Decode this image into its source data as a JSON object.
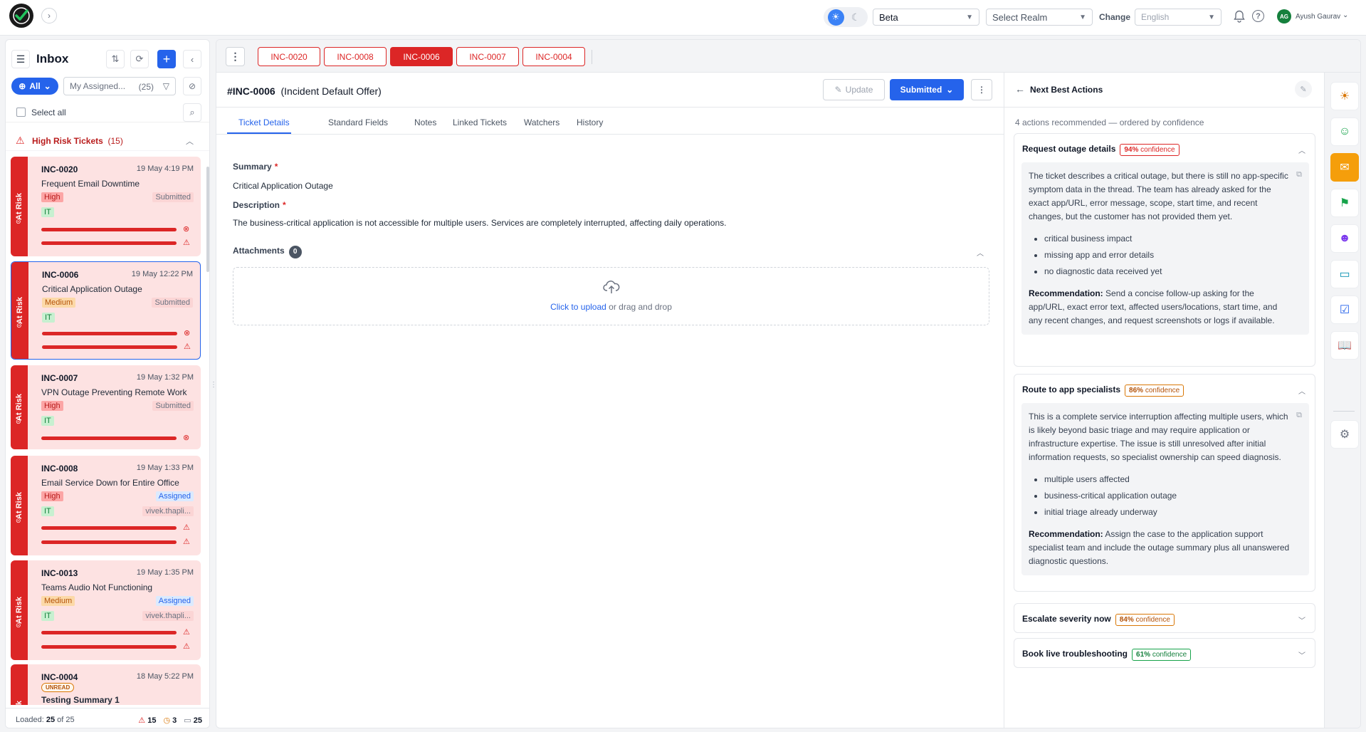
{
  "topbar": {
    "realm_mode_value": "Beta",
    "realm_placeholder": "Select Realm",
    "change_label": "Change",
    "language_value": "English",
    "user_initials": "AG",
    "user_name": "Ayush Gaurav",
    "help_glyph": "?",
    "icons": [
      "app-logo",
      "chevron-right-icon",
      "sun-icon",
      "moon-icon",
      "bell-icon",
      "help-icon",
      "chevron-down-icon"
    ]
  },
  "inbox": {
    "title": "Inbox",
    "filter_all": "All",
    "assigned_label": "My Assigned...",
    "assigned_count": "(25)",
    "select_all": "Select all",
    "group": {
      "title": "High Risk Tickets",
      "count": "(15)"
    },
    "risk_label": "At Risk",
    "tickets": [
      {
        "id": "INC-0020",
        "date": "19 May 4:19 PM",
        "title": "Frequent Email Downtime",
        "priority": "High",
        "status": "Submitted",
        "category": "IT",
        "assignee": ""
      },
      {
        "id": "INC-0006",
        "date": "19 May 12:22 PM",
        "title": "Critical Application Outage",
        "priority": "Medium",
        "status": "Submitted",
        "category": "IT",
        "assignee": ""
      },
      {
        "id": "INC-0007",
        "date": "19 May 1:32 PM",
        "title": "VPN Outage Preventing Remote Work",
        "priority": "High",
        "status": "Submitted",
        "category": "IT",
        "assignee": ""
      },
      {
        "id": "INC-0008",
        "date": "19 May 1:33 PM",
        "title": "Email Service Down for Entire Office",
        "priority": "High",
        "status": "Assigned",
        "category": "IT",
        "assignee": "vivek.thapli..."
      },
      {
        "id": "INC-0013",
        "date": "19 May 1:35 PM",
        "title": "Teams Audio Not Functioning",
        "priority": "Medium",
        "status": "Assigned",
        "category": "IT",
        "assignee": "vivek.thapli..."
      },
      {
        "id": "INC-0004",
        "date": "18 May 5:22 PM",
        "title": "Testing Summary 1",
        "unread": "UNREAD"
      }
    ],
    "footer": {
      "loaded_prefix": "Loaded:",
      "loaded": "25",
      "of_label": "of",
      "total": "25",
      "high": "15",
      "pending": "3",
      "all": "25"
    }
  },
  "tabs": [
    "INC-0020",
    "INC-0008",
    "INC-0006",
    "INC-0007",
    "INC-0004"
  ],
  "active_tab": "INC-0006",
  "ticket": {
    "number": "#INC-0006",
    "subtitle": "(Incident Default Offer)",
    "update_label": "Update",
    "status_label": "Submitted",
    "subtabs": [
      "Ticket Details",
      "Standard Fields",
      "Notes",
      "Linked Tickets",
      "Watchers",
      "History"
    ],
    "summary_label": "Summary",
    "summary_value": "Critical Application Outage",
    "description_label": "Description",
    "description_value": "The business-critical application is not accessible for multiple users. Services are completely interrupted, affecting daily operations.",
    "attachments_label": "Attachments",
    "attachments_count": "0",
    "upload_link": "Click to upload",
    "upload_rest": "or drag and drop"
  },
  "nba": {
    "title": "Next Best Actions",
    "subtitle": "4 actions recommended — ordered by confidence",
    "confidence_word": "confidence",
    "recommendation_label": "Recommendation:",
    "actions": [
      {
        "title": "Request outage details",
        "confidence": "94%",
        "body": "The ticket describes a critical outage, but there is still no app-specific symptom data in the thread. The team has already asked for the exact app/URL, error message, scope, start time, and recent changes, but the customer has not provided them yet.",
        "bullets": [
          "critical business impact",
          "missing app and error details",
          "no diagnostic data received yet"
        ],
        "recommendation": "Send a concise follow-up asking for the app/URL, exact error text, affected users/locations, start time, and any recent changes, and request screenshots or logs if available."
      },
      {
        "title": "Route to app specialists",
        "confidence": "86%",
        "body": "This is a complete service interruption affecting multiple users, which is likely beyond basic triage and may require application or infrastructure expertise. The issue is still unresolved after initial information requests, so specialist ownership can speed diagnosis.",
        "bullets": [
          "multiple users affected",
          "business-critical application outage",
          "initial triage already underway"
        ],
        "recommendation": "Assign the case to the application support specialist team and include the outage summary plus all unanswered diagnostic questions."
      },
      {
        "title": "Escalate severity now",
        "confidence": "84%"
      },
      {
        "title": "Book live troubleshooting",
        "confidence": "61%"
      }
    ]
  },
  "rail_icons": [
    "lightbulb-icon",
    "smiley-icon",
    "chat-sparkle-icon",
    "flag-chat-icon",
    "bot-icon",
    "ticket-icon",
    "checklist-icon",
    "book-icon",
    "gear-icon"
  ],
  "colors": {
    "accent": "#2563eb",
    "danger": "#dc2626",
    "warning": "#f59e0b",
    "success": "#16a34a"
  }
}
